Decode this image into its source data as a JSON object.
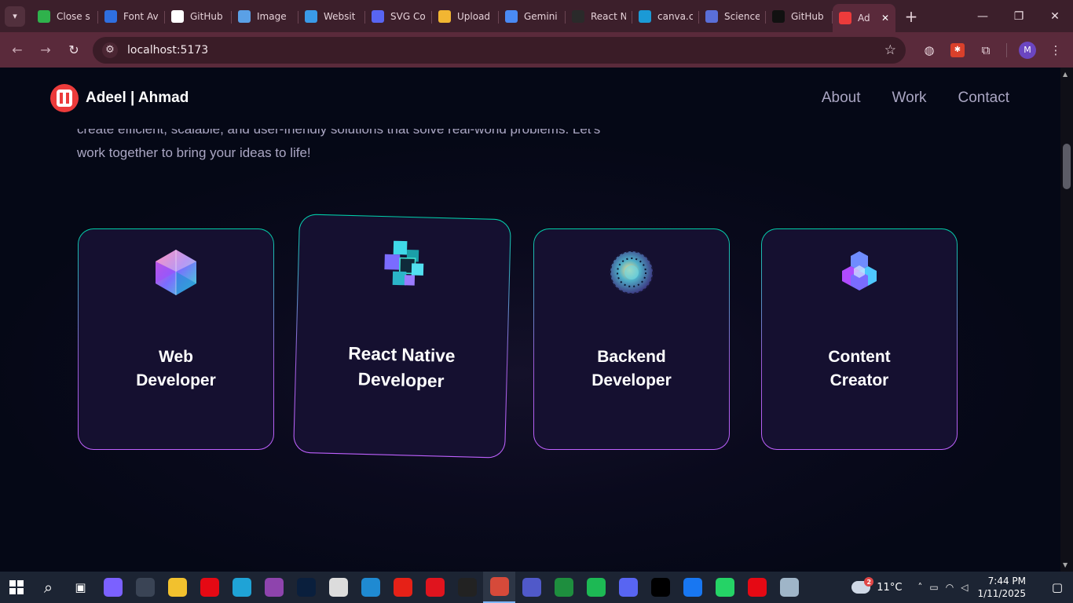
{
  "browser": {
    "tabs": [
      {
        "title": "Close s",
        "icon": "green-square-icon",
        "color": "#2fb24c"
      },
      {
        "title": "Font Av",
        "icon": "flag-icon",
        "color": "#2f6fe0"
      },
      {
        "title": "GitHub",
        "icon": "mg-icon",
        "color": "#ffffff"
      },
      {
        "title": "Image",
        "icon": "image-frame-icon",
        "color": "#5aa0e6"
      },
      {
        "title": "Websit",
        "icon": "globe-icon",
        "color": "#3a9ae8"
      },
      {
        "title": "SVG Co",
        "icon": "svg-icon",
        "color": "#5865f2"
      },
      {
        "title": "Upload",
        "icon": "upload-icon",
        "color": "#f2b632"
      },
      {
        "title": "Gemini",
        "icon": "gemini-icon",
        "color": "#4a8af4"
      },
      {
        "title": "React N",
        "icon": "openai-icon",
        "color": "#2a2a2a"
      },
      {
        "title": "canva.c",
        "icon": "canva-icon",
        "color": "#1b9ad6"
      },
      {
        "title": "Science",
        "icon": "science-icon",
        "color": "#5a6fd8"
      },
      {
        "title": "GitHub",
        "icon": "github-icon",
        "color": "#111111"
      }
    ],
    "active_tab": {
      "title": "Ad",
      "icon": "site-logo-icon",
      "color": "#ec3b3b"
    },
    "new_tab": "+",
    "url": "localhost:5173",
    "profile_initial": "M"
  },
  "site": {
    "brand_first": "Adeel",
    "brand_sep": " | ",
    "brand_last": "Ahmad",
    "nav": [
      "About",
      "Work",
      "Contact"
    ],
    "intro_line1": "create efficient, scalable, and user-friendly solutions that solve real-world problems. Let's",
    "intro_line2": "work together to bring your ideas to life!",
    "cards": [
      {
        "title": "Web\nDeveloper",
        "icon": "web-icosahedron-icon"
      },
      {
        "title": "React Native\nDeveloper",
        "icon": "mobile-cubes-icon"
      },
      {
        "title": "Backend\nDeveloper",
        "icon": "backend-sphere-icon"
      },
      {
        "title": "Content\nCreator",
        "icon": "creator-hexagon-icon"
      }
    ]
  },
  "taskbar": {
    "apps": [
      {
        "name": "copilot",
        "color": "#7b61ff"
      },
      {
        "name": "settings",
        "color": "#3a4455"
      },
      {
        "name": "file-explorer",
        "color": "#f2c12e"
      },
      {
        "name": "netflix",
        "color": "#e50914"
      },
      {
        "name": "edge",
        "color": "#1fa3d6"
      },
      {
        "name": "github-desktop",
        "color": "#8e44ad"
      },
      {
        "name": "photoshop",
        "color": "#0a1f3d"
      },
      {
        "name": "inkscape",
        "color": "#dcdcdc"
      },
      {
        "name": "vscode",
        "color": "#1f8ad2"
      },
      {
        "name": "youtube",
        "color": "#e62117"
      },
      {
        "name": "opera",
        "color": "#e0141e"
      },
      {
        "name": "github",
        "color": "#222222"
      },
      {
        "name": "chrome",
        "color": "#d64a3a"
      },
      {
        "name": "teams",
        "color": "#5059c9"
      },
      {
        "name": "meet",
        "color": "#1e8e3e"
      },
      {
        "name": "spotify",
        "color": "#1db954"
      },
      {
        "name": "discord",
        "color": "#5865f2"
      },
      {
        "name": "vercel",
        "color": "#000000"
      },
      {
        "name": "facebook",
        "color": "#1877f2"
      },
      {
        "name": "whatsapp",
        "color": "#25d366"
      },
      {
        "name": "netflix-2",
        "color": "#e50914"
      },
      {
        "name": "control-panel",
        "color": "#9fb5c8"
      }
    ],
    "weather_badge": "2",
    "temperature": "11°C",
    "time": "7:44 PM",
    "date": "1/11/2025"
  }
}
